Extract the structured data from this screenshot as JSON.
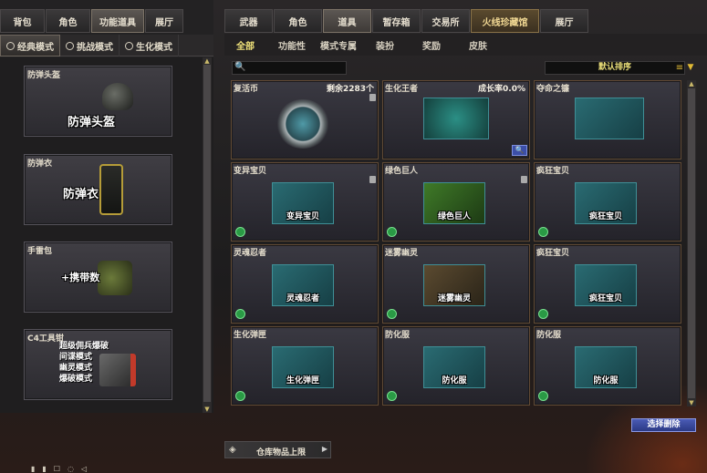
{
  "left_tabs": [
    "背包",
    "角色",
    "功能道具",
    "展厅"
  ],
  "left_subtabs": [
    {
      "label": "经典模式",
      "icon": "gear-icon"
    },
    {
      "label": "挑战模式",
      "icon": "target-icon"
    },
    {
      "label": "生化模式",
      "icon": "biohazard-icon"
    }
  ],
  "left_items": [
    {
      "title": "防弹头盔",
      "name": "防弹头盔"
    },
    {
      "title": "防弹衣",
      "name": "防弹衣"
    },
    {
      "title": "手雷包",
      "name": "+携带数"
    },
    {
      "title": "C4工具钳",
      "lines": [
        "超级佣兵爆破",
        "间谍模式",
        "幽灵模式",
        "爆破模式"
      ]
    }
  ],
  "right_tabs": [
    "武器",
    "角色",
    "道具",
    "暂存箱",
    "交易所",
    "火线珍藏馆",
    "展厅"
  ],
  "right_subtabs": [
    "全部",
    "功能性",
    "模式专属",
    "装扮",
    "奖励",
    "皮肤"
  ],
  "search": {
    "placeholder": ""
  },
  "sort_label": "默认排序",
  "items": [
    {
      "title": "复活币",
      "meta": "剩余2283个",
      "label": "",
      "lock": true,
      "mag": false
    },
    {
      "title": "生化王者",
      "meta": "成长率0.0%",
      "label": "",
      "lock": false,
      "mag": true
    },
    {
      "title": "夺命之镰",
      "meta": "",
      "label": "",
      "lock": false,
      "mag": false
    },
    {
      "title": "变异宝贝",
      "meta": "",
      "label": "变异宝贝",
      "lock": true,
      "mag": false
    },
    {
      "title": "绿色巨人",
      "meta": "",
      "label": "绿色巨人",
      "lock": true,
      "mag": false
    },
    {
      "title": "疯狂宝贝",
      "meta": "",
      "label": "疯狂宝贝",
      "lock": false,
      "mag": false
    },
    {
      "title": "灵魂忍者",
      "meta": "",
      "label": "灵魂忍者",
      "lock": false,
      "mag": false
    },
    {
      "title": "迷雾幽灵",
      "meta": "",
      "label": "迷雾幽灵",
      "lock": false,
      "mag": false
    },
    {
      "title": "疯狂宝贝",
      "meta": "",
      "label": "疯狂宝贝",
      "lock": false,
      "mag": false
    },
    {
      "title": "生化弹匣",
      "meta": "",
      "label": "生化弹匣",
      "lock": false,
      "mag": false
    },
    {
      "title": "防化服",
      "meta": "",
      "label": "防化服",
      "lock": false,
      "mag": false
    },
    {
      "title": "防化服",
      "meta": "",
      "label": "防化服",
      "lock": false,
      "mag": false
    }
  ],
  "select_button": "选择删除",
  "storage_label": "仓库物品上限",
  "colors": {
    "accent": "#f0e27a",
    "card_border": "#614a34",
    "button": "#3b4ca5",
    "teal": "#2a6b72"
  }
}
